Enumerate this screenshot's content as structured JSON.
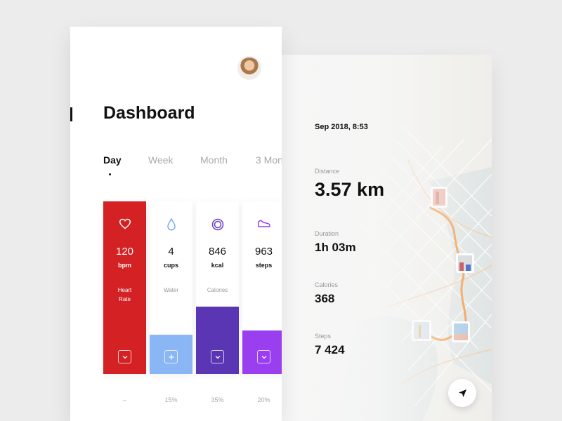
{
  "dashboard": {
    "title": "Dashboard",
    "tabs": [
      {
        "label": "Day",
        "active": true
      },
      {
        "label": "Week",
        "active": false
      },
      {
        "label": "Month",
        "active": false
      },
      {
        "label": "3 Mon",
        "active": false
      }
    ],
    "cards": [
      {
        "value": "120",
        "unit": "bpm",
        "label": "Heart Rate",
        "icon": "heart-icon",
        "action": "chevron-down-icon",
        "color": "#d32124",
        "percent": "–"
      },
      {
        "value": "4",
        "unit": "cups",
        "label": "Water",
        "icon": "water-drop-icon",
        "action": "plus-icon",
        "color": "#8ab6f5",
        "percent": "15%"
      },
      {
        "value": "846",
        "unit": "kcal",
        "label": "Calories",
        "icon": "ring-icon",
        "action": "chevron-down-icon",
        "color": "#5a35b4",
        "percent": "35%"
      },
      {
        "value": "963",
        "unit": "steps",
        "label": "",
        "icon": "shoe-icon",
        "action": "chevron-down-icon",
        "color": "#9a3ff0",
        "percent": "20%"
      }
    ]
  },
  "activity": {
    "date": "Sep 2018, 8:53",
    "stats": [
      {
        "label": "Distance",
        "value": "3.57 km"
      },
      {
        "label": "Duration",
        "value": "1h 03m"
      },
      {
        "label": "Calories",
        "value": "368"
      },
      {
        "label": "Steps",
        "value": "7 424"
      }
    ]
  },
  "colors": {
    "red": "#d32124",
    "water": "#8ab6f5",
    "calories": "#5a35b4",
    "steps": "#9a3ff0",
    "route": "#f39a4a"
  }
}
